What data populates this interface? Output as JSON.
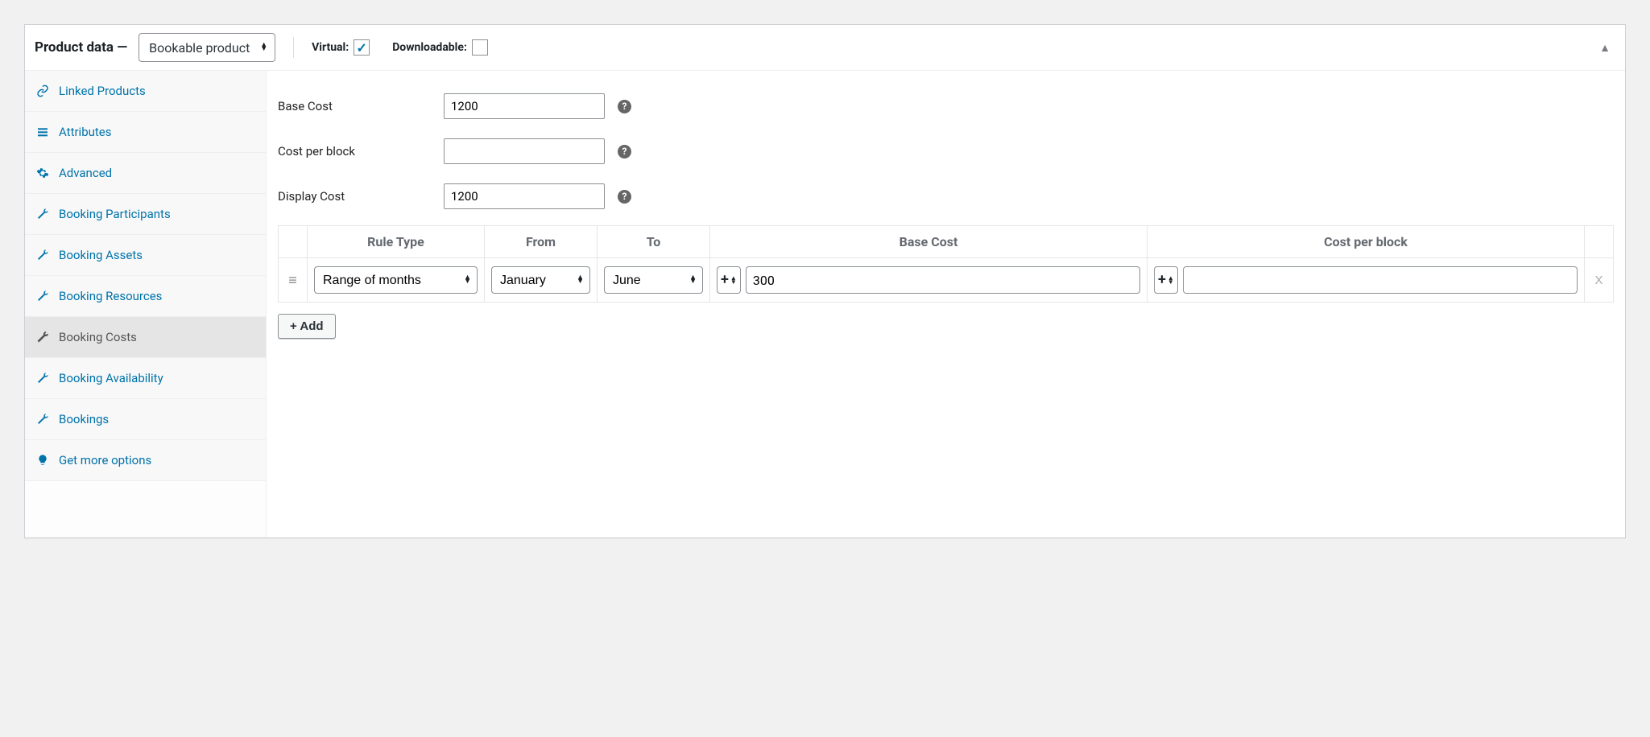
{
  "header": {
    "title_prefix": "Product data —",
    "product_type": "Bookable product",
    "virtual_label": "Virtual:",
    "virtual_checked": "✓",
    "downloadable_label": "Downloadable:"
  },
  "sidebar": {
    "items": [
      {
        "label": "Linked Products",
        "icon": "link"
      },
      {
        "label": "Attributes",
        "icon": "list"
      },
      {
        "label": "Advanced",
        "icon": "gear"
      },
      {
        "label": "Booking Participants",
        "icon": "wrench"
      },
      {
        "label": "Booking Assets",
        "icon": "wrench"
      },
      {
        "label": "Booking Resources",
        "icon": "wrench"
      },
      {
        "label": "Booking Costs",
        "icon": "wrench",
        "active": true
      },
      {
        "label": "Booking Availability",
        "icon": "wrench"
      },
      {
        "label": "Bookings",
        "icon": "wrench"
      },
      {
        "label": "Get more options",
        "icon": "lightbulb"
      }
    ]
  },
  "fields": {
    "base_cost_label": "Base Cost",
    "base_cost_value": "1200",
    "cost_per_block_label": "Cost per block",
    "cost_per_block_value": "",
    "display_cost_label": "Display Cost",
    "display_cost_value": "1200"
  },
  "table": {
    "headers": {
      "rule_type": "Rule Type",
      "from": "From",
      "to": "To",
      "base_cost": "Base Cost",
      "cost_per_block": "Cost per block"
    },
    "row": {
      "rule_type": "Range of months",
      "from": "January",
      "to": "June",
      "base_cost_op": "+",
      "base_cost_value": "300",
      "cost_per_block_op": "+",
      "cost_per_block_value": ""
    }
  },
  "buttons": {
    "add": "+ Add"
  }
}
